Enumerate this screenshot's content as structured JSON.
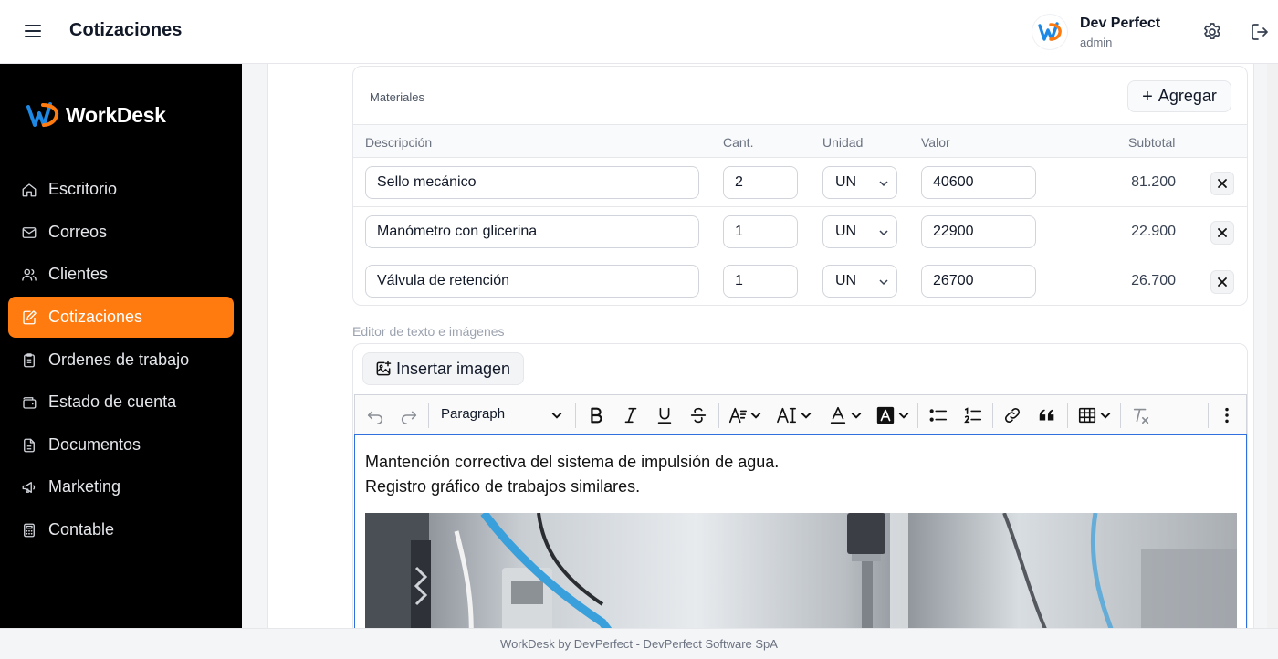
{
  "header": {
    "title": "Cotizaciones",
    "user_name": "Dev Perfect",
    "user_role": "admin"
  },
  "brand": {
    "name": "WorkDesk",
    "accent": "#ff7a0f"
  },
  "sidebar": {
    "items": [
      {
        "label": "Escritorio",
        "icon": "home-icon"
      },
      {
        "label": "Correos",
        "icon": "mail-icon"
      },
      {
        "label": "Clientes",
        "icon": "users-icon"
      },
      {
        "label": "Cotizaciones",
        "icon": "edit-document-icon",
        "active": true
      },
      {
        "label": "Ordenes de trabajo",
        "icon": "clipboard-icon"
      },
      {
        "label": "Estado de cuenta",
        "icon": "wallet-icon"
      },
      {
        "label": "Documentos",
        "icon": "document-icon"
      },
      {
        "label": "Marketing",
        "icon": "megaphone-icon"
      },
      {
        "label": "Contable",
        "icon": "calculator-icon"
      }
    ]
  },
  "materials": {
    "title": "Materiales",
    "add_label": "Agregar",
    "columns": [
      "Descripción",
      "Cant.",
      "Unidad",
      "Valor",
      "Subtotal"
    ],
    "rows": [
      {
        "description": "Sello mecánico",
        "qty": "2",
        "unit": "UN",
        "value": "40600",
        "subtotal": "81.200"
      },
      {
        "description": "Manómetro con glicerina",
        "qty": "1",
        "unit": "UN",
        "value": "22900",
        "subtotal": "22.900"
      },
      {
        "description": "Válvula de retención",
        "qty": "1",
        "unit": "UN",
        "value": "26700",
        "subtotal": "26.700"
      }
    ]
  },
  "editor": {
    "label": "Editor de texto e imágenes",
    "insert_image_label": "Insertar imagen",
    "paragraph_style": "Paragraph",
    "content": [
      "Mantención correctiva del sistema de impulsión de agua.",
      "Registro gráfico de trabajos similares."
    ]
  },
  "footer": {
    "text": "WorkDesk by DevPerfect - DevPerfect Software SpA"
  }
}
